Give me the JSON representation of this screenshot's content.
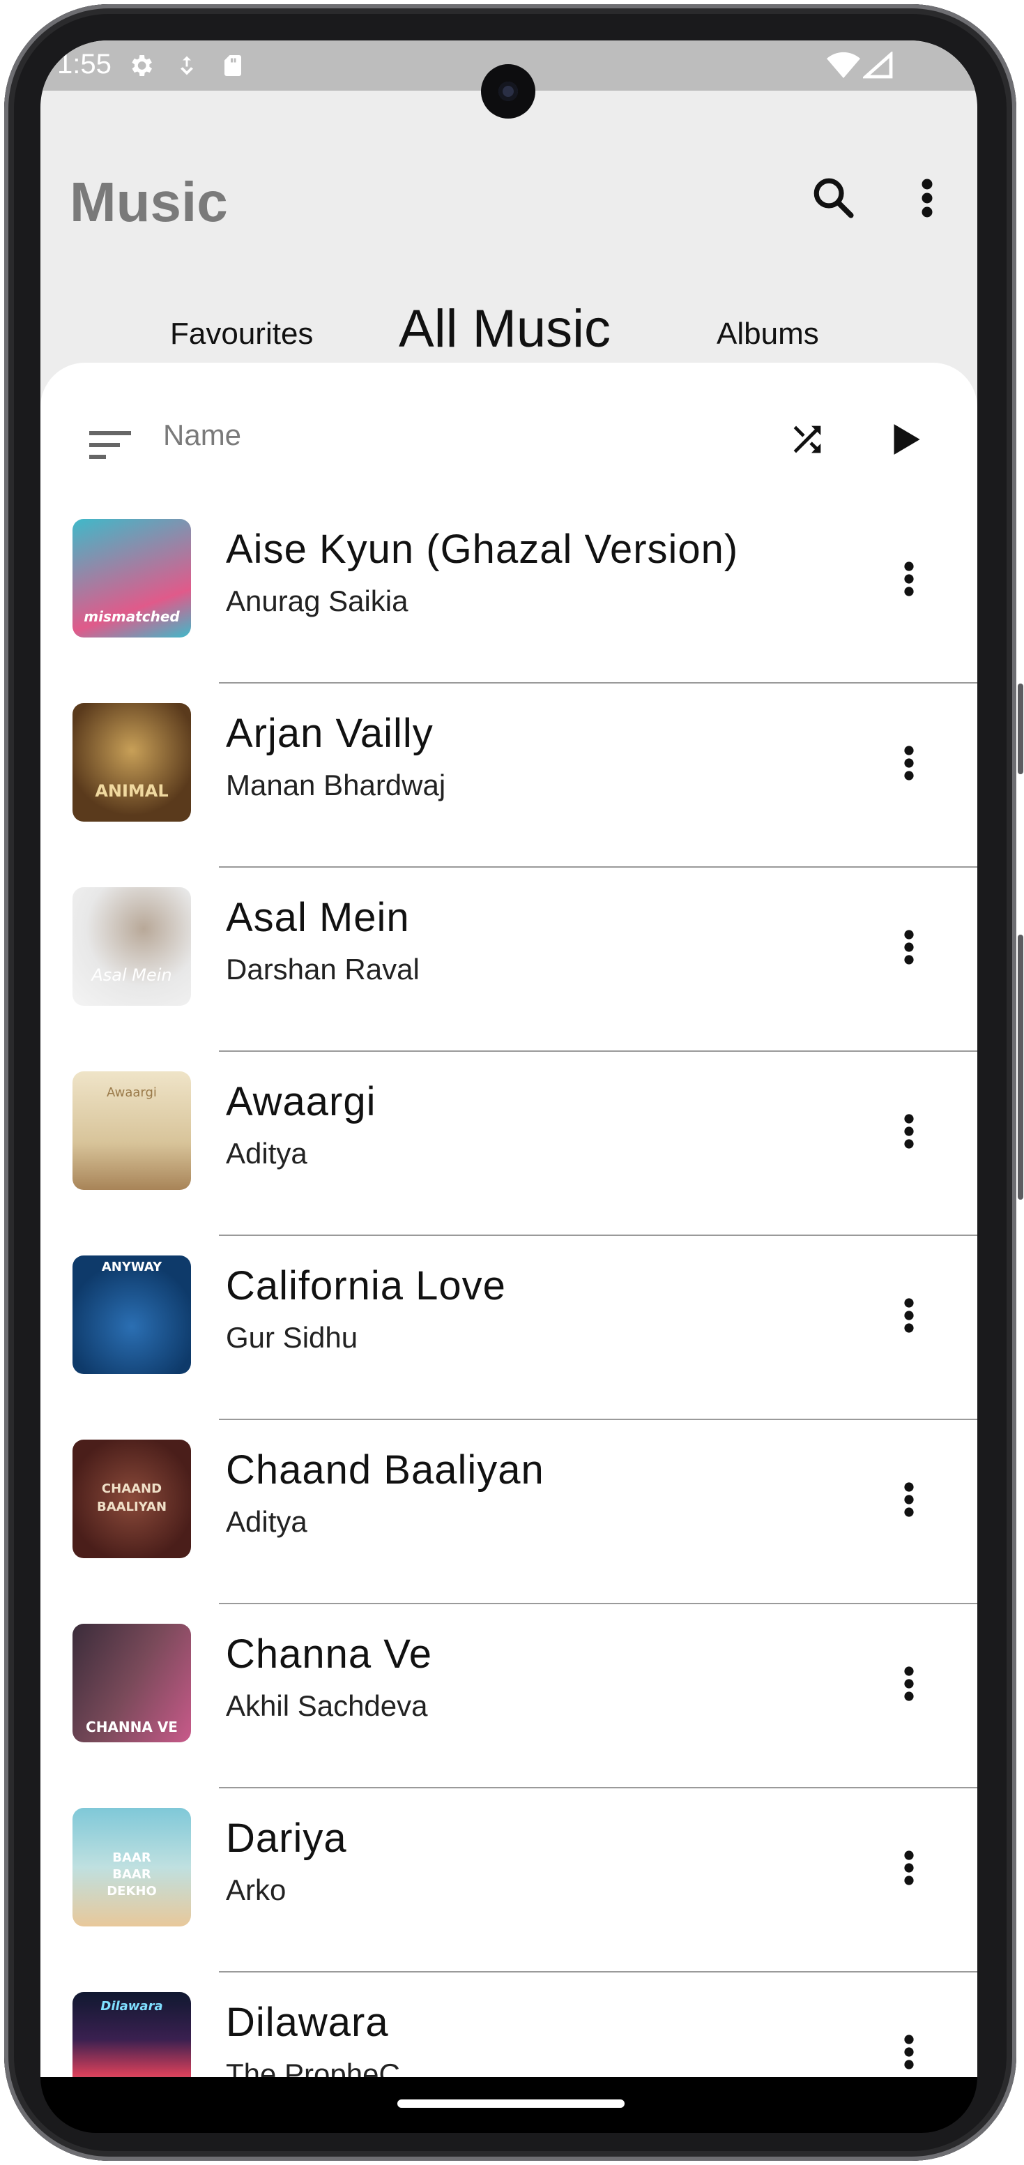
{
  "status_bar": {
    "time": "1:55"
  },
  "app_bar": {
    "title": "Music",
    "icons": [
      "search-icon",
      "more-vert-icon"
    ]
  },
  "tabs": [
    {
      "label": "Favourites",
      "selected": false
    },
    {
      "label": "All Music",
      "selected": true
    },
    {
      "label": "Albums",
      "selected": false
    }
  ],
  "sort": {
    "label": "Name",
    "icons": [
      "sort-icon",
      "shuffle-icon",
      "play-icon"
    ]
  },
  "songs": [
    {
      "title": "Aise Kyun (Ghazal Version)",
      "artist": "Anurag Saikia",
      "art_text": "mismatched",
      "art_colors": [
        "#3fb9c9",
        "#e05a8a"
      ]
    },
    {
      "title": "Arjan Vailly",
      "artist": "Manan Bhardwaj",
      "art_text": "ANIMAL",
      "art_colors": [
        "#5a3a1c",
        "#c8a058"
      ]
    },
    {
      "title": "Asal Mein",
      "artist": "Darshan Raval",
      "art_text": "Asal Mein",
      "art_colors": [
        "#d9d9d9",
        "#f4f4f4"
      ]
    },
    {
      "title": "Awaargi",
      "artist": "Aditya",
      "art_text": "Awaargi",
      "art_colors": [
        "#e9dcc0",
        "#b89868"
      ]
    },
    {
      "title": "California Love",
      "artist": "Gur Sidhu",
      "art_text": "ANYWAY",
      "art_colors": [
        "#0e3a6a",
        "#2b6fb3"
      ]
    },
    {
      "title": "Chaand Baaliyan",
      "artist": "Aditya",
      "art_text": "CHAAND BAALIYAN",
      "art_colors": [
        "#4a1e1a",
        "#8a4a3a"
      ]
    },
    {
      "title": "Channa Ve",
      "artist": "Akhil Sachdeva",
      "art_text": "CHANNA VE",
      "art_colors": [
        "#3a2c3a",
        "#c85a8a"
      ]
    },
    {
      "title": "Dariya",
      "artist": "Arko",
      "art_text": "BAAR BAAR DEKHO",
      "art_colors": [
        "#7fc8d8",
        "#e8c89a"
      ]
    },
    {
      "title": "Dilawara",
      "artist": "The PropheC",
      "art_text": "Dilawara",
      "art_colors": [
        "#101830",
        "#d8405a"
      ]
    }
  ]
}
